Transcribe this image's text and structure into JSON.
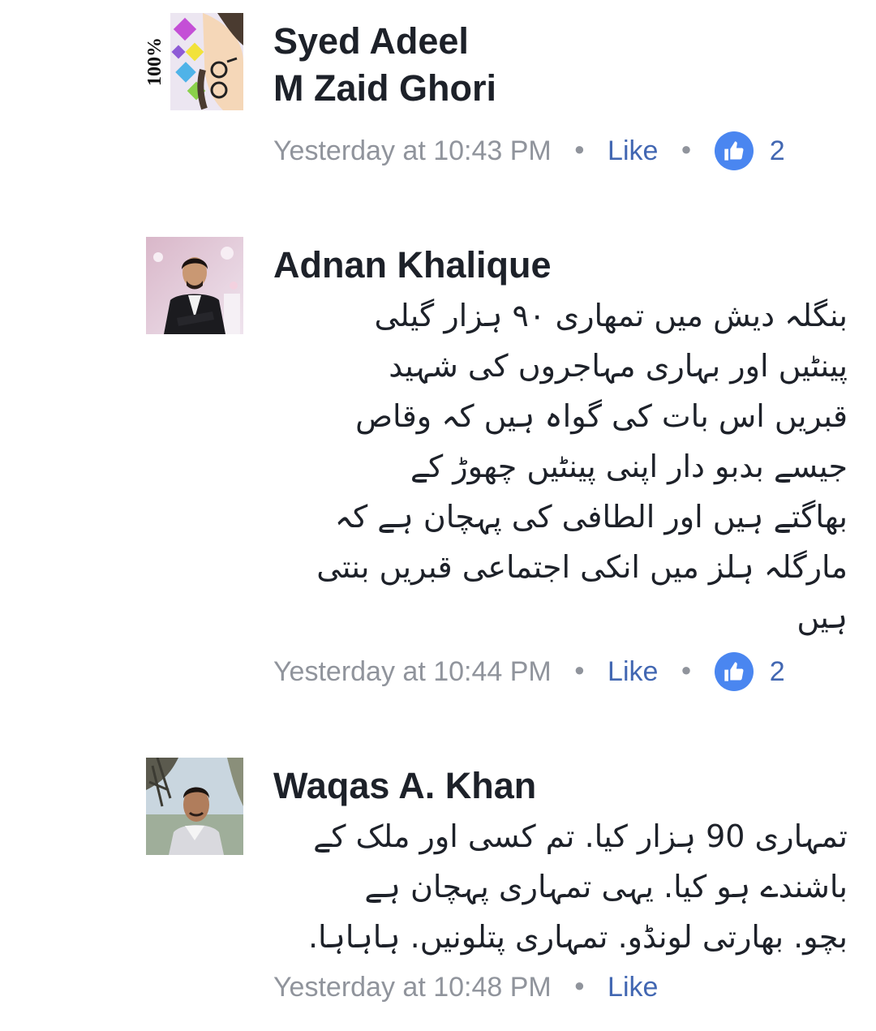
{
  "comments": [
    {
      "author_line1": "Syed Adeel",
      "author_line2": "M Zaid Ghori",
      "avatar": "cartoon-face-avatar",
      "avatar_badge": "100%",
      "time": "Yesterday at 10:43 PM",
      "like_label": "Like",
      "reaction_icon": "thumbs-up-icon",
      "reaction_count": "2"
    },
    {
      "author": "Adnan Khalique",
      "avatar": "man-in-suit-photo-avatar",
      "body": "بنگلہ دیش میں تمھاری ۹۰ ہزار گیلی\nپینٹیں اور بہاری مہاجروں کی شہید\nقبریں اس بات کی گواہ ہیں کہ وقاص\nجیسے بدبو دار اپنی پینٹیں چھوڑ کے\nبھاگتے ہیں اور الطافی کی پہچان ہے کہ\nمارگلہ ہلز میں انکی اجتماعی قبریں بنتی\nہیں",
      "time": "Yesterday at 10:44 PM",
      "like_label": "Like",
      "reaction_icon": "thumbs-up-icon",
      "reaction_count": "2"
    },
    {
      "author": "Waqas A. Khan",
      "avatar": "man-outdoor-photo-avatar",
      "body": "تمہاری 90 ہزار کیا. تم کسی اور ملک کے\nباشندے ہو کیا. یہی تمہاری پہچان ہے\nبچو. بھارتی لونڈو. تمہاری پتلونیں. ہاہاہا.",
      "time": "Yesterday at 10:48 PM",
      "like_label": "Like"
    }
  ],
  "colors": {
    "author": "#1d2129",
    "meta": "#90949c",
    "link": "#4267b2",
    "badge": "#4a86f0"
  }
}
